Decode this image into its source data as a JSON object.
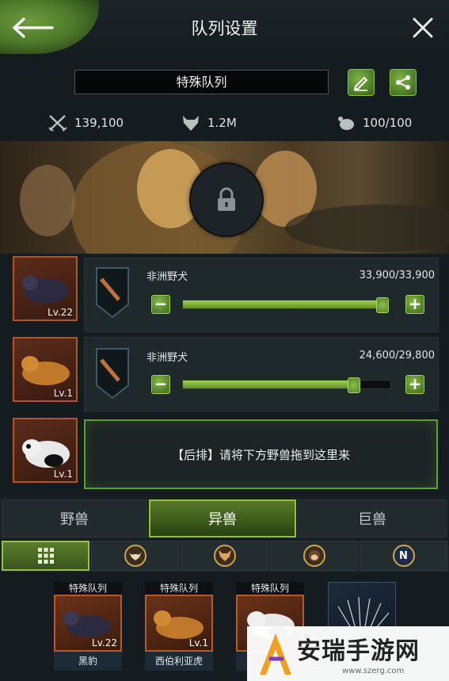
{
  "header": {
    "title": "队列设置"
  },
  "troop": {
    "name": "特殊队列",
    "stats": {
      "power": "139,100",
      "strength": "1.2M",
      "capacity": "100/100"
    }
  },
  "slots": [
    {
      "level": "Lv.22",
      "beast": "非洲野犬",
      "count": "33,900/33,900",
      "fill": 0.96
    },
    {
      "level": "Lv.1",
      "beast": "非洲野犬",
      "count": "24,600/29,800",
      "fill": 0.825
    },
    {
      "level": "Lv.1",
      "drop_hint": "【后排】请将下方野兽拖到这里来"
    }
  ],
  "tabs": [
    "野兽",
    "异兽",
    "巨兽"
  ],
  "active_tab": 1,
  "filters": [
    "grid-icon",
    "bull-icon",
    "fox-icon",
    "monkey-icon",
    "n-badge-icon"
  ],
  "cards": [
    {
      "tag": "特殊队列",
      "level": "Lv.22",
      "name": "黑豹"
    },
    {
      "tag": "特殊队列",
      "level": "Lv.1",
      "name": "西伯利亚虎"
    },
    {
      "tag": "特殊队列",
      "level": "",
      "name": ""
    }
  ],
  "watermark": {
    "text": "安瑞手游网",
    "url": "www.szerg.com"
  },
  "colors": {
    "accent_green": "#8fc146",
    "portrait_border": "#b3552b",
    "background": "#141c1f"
  }
}
